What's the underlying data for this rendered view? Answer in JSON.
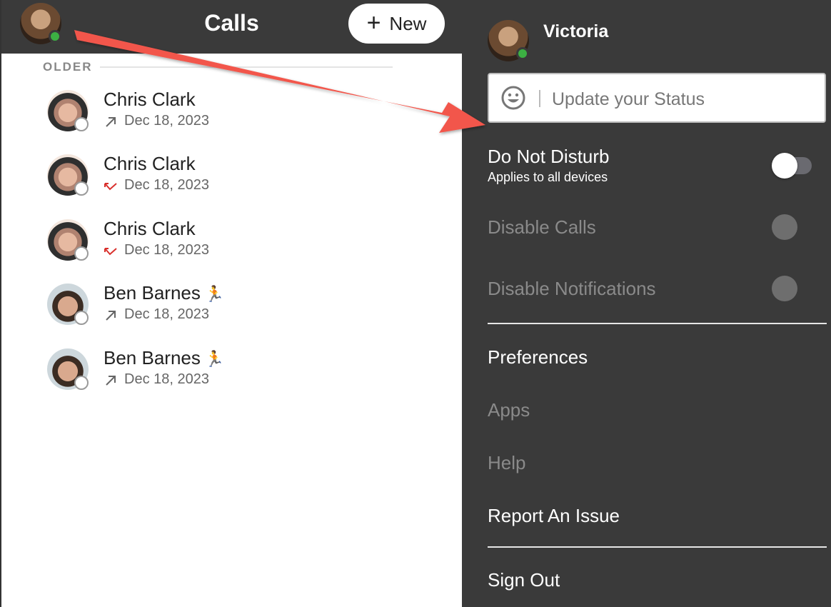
{
  "header": {
    "title": "Calls",
    "new_button_label": "New",
    "new_button_plus": "+"
  },
  "calls": {
    "section_label": "OLDER",
    "items": [
      {
        "name": "Chris Clark",
        "emoji": "",
        "direction": "outgoing",
        "date": "Dec 18, 2023"
      },
      {
        "name": "Chris Clark",
        "emoji": "",
        "direction": "missed",
        "date": "Dec 18, 2023"
      },
      {
        "name": "Chris Clark",
        "emoji": "",
        "direction": "missed",
        "date": "Dec 18, 2023"
      },
      {
        "name": "Ben Barnes",
        "emoji": "🏃",
        "direction": "outgoing",
        "date": "Dec 18, 2023"
      },
      {
        "name": "Ben Barnes",
        "emoji": "🏃",
        "direction": "outgoing",
        "date": "Dec 18, 2023"
      }
    ]
  },
  "profile": {
    "username": "Victoria",
    "status_placeholder": "Update your Status",
    "dnd_label": "Do Not Disturb",
    "dnd_sublabel": "Applies to all devices",
    "dnd_enabled": false,
    "disable_calls_label": "Disable Calls",
    "disable_notifications_label": "Disable Notifications"
  },
  "menu": {
    "preferences": "Preferences",
    "apps": "Apps",
    "help": "Help",
    "report_issue": "Report An Issue",
    "sign_out": "Sign Out"
  },
  "colors": {
    "panel_bg": "#3a3a3a",
    "online": "#3cb043",
    "missed": "#d9302c",
    "annotation_arrow": "#f2574b"
  },
  "icons": {
    "outgoing": "arrow-up-right-icon",
    "missed": "missed-call-icon",
    "status": "smiley-icon"
  }
}
